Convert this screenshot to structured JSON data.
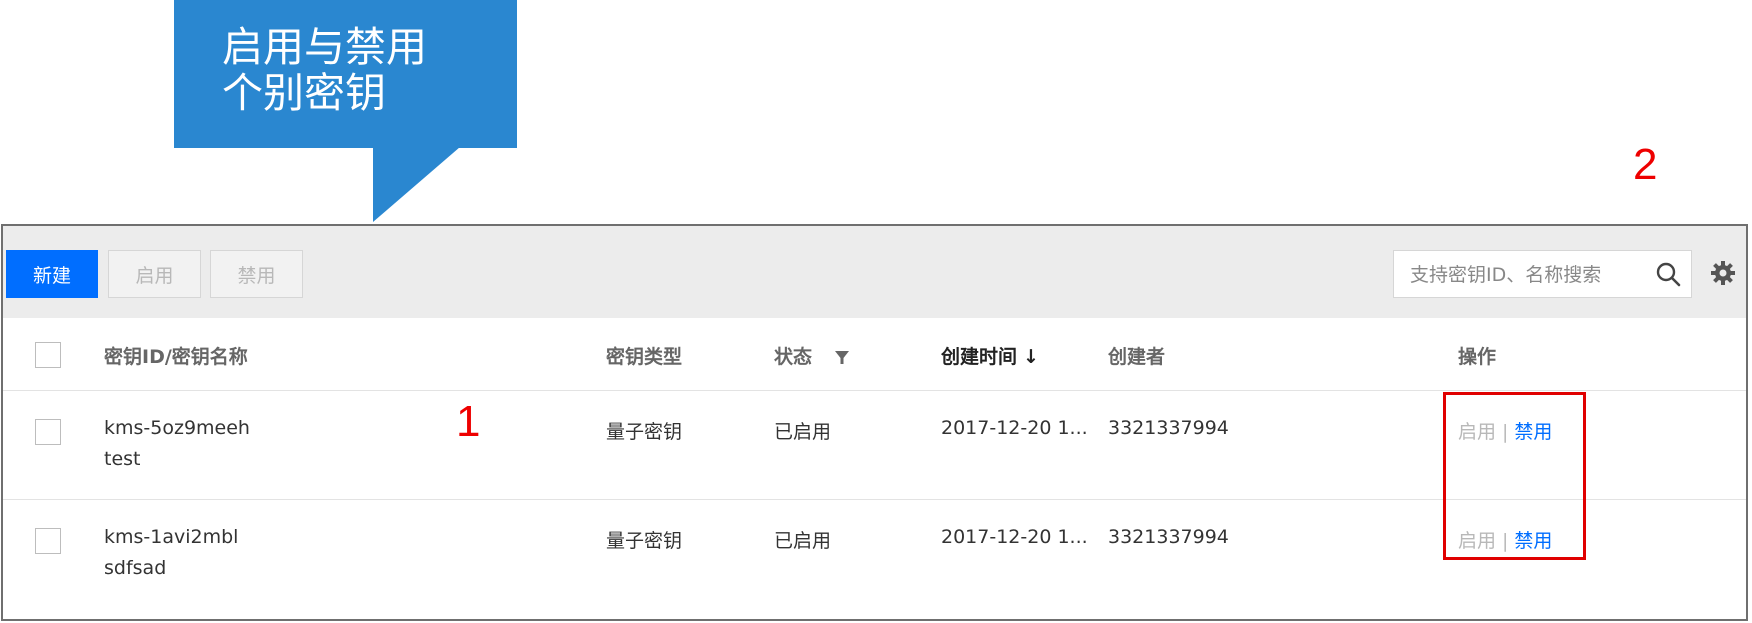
{
  "callout": {
    "line1": "启用与禁用",
    "line2": "个别密钥"
  },
  "markers": {
    "one": "1",
    "two": "2"
  },
  "toolbar": {
    "new_label": "新建",
    "enable_label": "启用",
    "disable_label": "禁用",
    "search_placeholder": "支持密钥ID、名称搜索"
  },
  "table": {
    "columns": {
      "name": "密钥ID/密钥名称",
      "type": "密钥类型",
      "status": "状态",
      "time": "创建时间",
      "time_sort": "↓",
      "creator": "创建者",
      "ops": "操作"
    },
    "rows": [
      {
        "id": "kms-5oz9meeh",
        "name": "test",
        "type": "量子密钥",
        "status": "已启用",
        "time": "2017-12-20 1...",
        "creator": "3321337994",
        "op_enable": "启用",
        "op_sep": "|",
        "op_disable": "禁用"
      },
      {
        "id": "kms-1avi2mbl",
        "name": "sdfsad",
        "type": "量子密钥",
        "status": "已启用",
        "time": "2017-12-20 1...",
        "creator": "3321337994",
        "op_enable": "启用",
        "op_sep": "|",
        "op_disable": "禁用"
      }
    ]
  },
  "colors": {
    "accent": "#006eff",
    "callout": "#2a87d0",
    "annotation": "#e00000"
  },
  "icons": {
    "search": "search-icon",
    "settings": "gear-icon",
    "filter": "filter-icon"
  }
}
